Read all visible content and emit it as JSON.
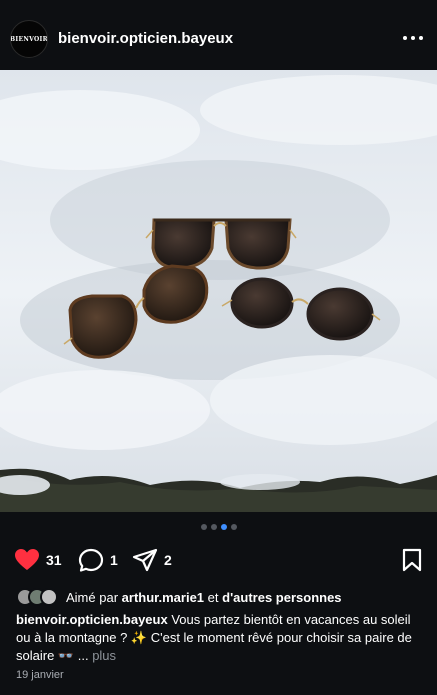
{
  "account": {
    "avatar_text": "BIENVOIR",
    "username": "bienvoir.opticien.bayeux"
  },
  "carousel": {
    "total": 4,
    "active_index": 2
  },
  "actions": {
    "likes_count": "31",
    "comments_count": "1",
    "shares_count": "2"
  },
  "likes": {
    "prefix": "Aimé par",
    "user": "arthur.marie1",
    "suffix_connector": "et",
    "suffix": "d'autres personnes"
  },
  "caption": {
    "username": "bienvoir.opticien.bayeux",
    "text": "Vous partez bientôt en vacances au soleil ou à la montagne ? ✨ C'est le moment rêvé pour choisir sa paire de solaire 👓",
    "ellipsis": "...",
    "more_label": "plus"
  },
  "date": "19 janvier",
  "colors": {
    "background": "#0d0f12",
    "like_red": "#ff3040",
    "dot_active": "#3f8fff"
  },
  "icons": [
    "heart-icon",
    "comment-icon",
    "share-icon",
    "bookmark-icon",
    "more-icon"
  ]
}
